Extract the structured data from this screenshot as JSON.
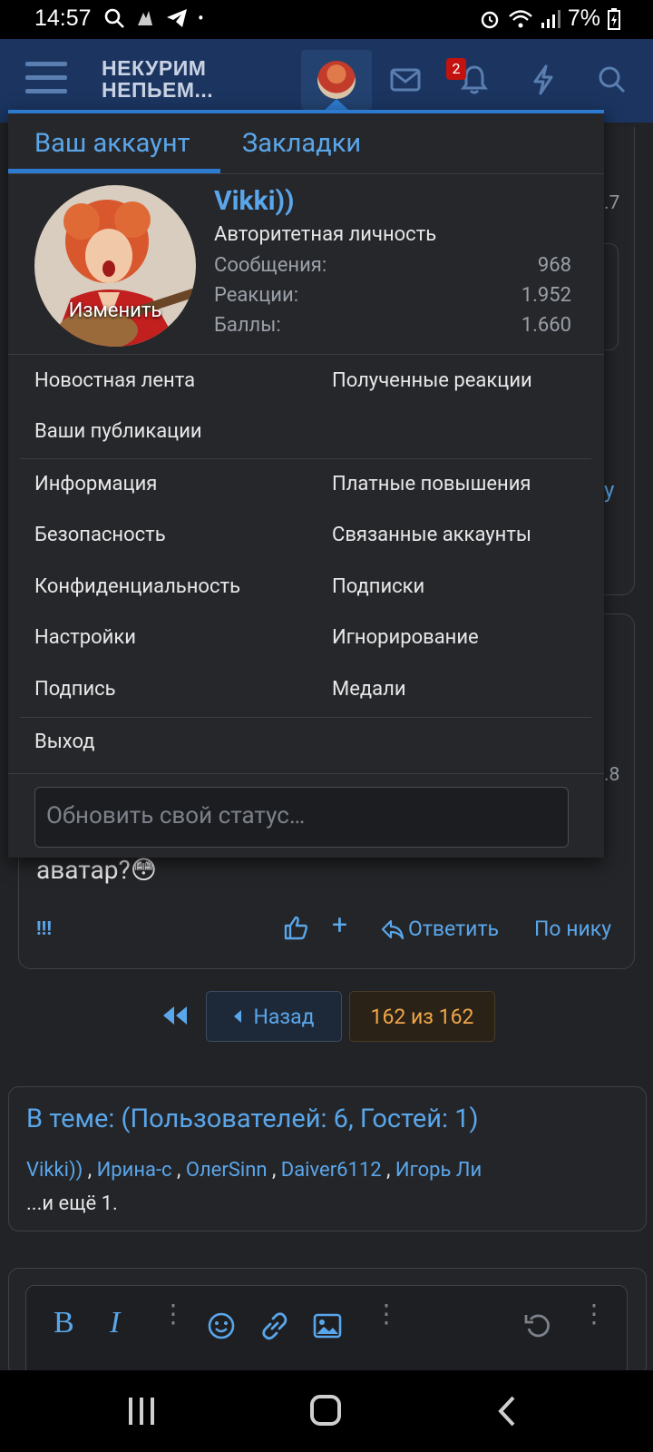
{
  "status_bar": {
    "time": "14:57",
    "battery": "7%"
  },
  "header": {
    "logo_line1": "НЕКУРИМ",
    "logo_line2": "НЕПЬЕМ...",
    "alerts_count": "2"
  },
  "account_menu": {
    "tabs": [
      "Ваш аккаунт",
      "Закладки"
    ],
    "user": {
      "name": "Vikki))",
      "title": "Авторитетная личность",
      "avatar_action": "Изменить",
      "stats": [
        {
          "label": "Сообщения:",
          "value": "968"
        },
        {
          "label": "Реакции:",
          "value": "1.952"
        },
        {
          "label": "Баллы:",
          "value": "1.660"
        }
      ]
    },
    "links_group1": {
      "left": [
        "Новостная лента",
        "Ваши публикации"
      ],
      "right": [
        "Полученные реакции"
      ]
    },
    "links_group2": {
      "left": [
        "Информация",
        "Безопасность",
        "Конфиденциальность",
        "Настройки",
        "Подпись"
      ],
      "right": [
        "Платные повышения",
        "Связанные аккаунты",
        "Подписки",
        "Игнорирование",
        "Медали"
      ]
    },
    "logout": "Выход",
    "status_placeholder": "Обновить свой статус…"
  },
  "background_post": {
    "text": "аватар?😳",
    "side_fragments": [
      ".7",
      "у",
      ".8"
    ],
    "actions": {
      "report": "!!!",
      "reply": "Ответить",
      "by_nick": "По нику"
    }
  },
  "pagination": {
    "back": "Назад",
    "current": "162 из 162"
  },
  "online_block": {
    "title": "В теме: (Пользователей: 6, Гостей: 1)",
    "users": [
      "Vikki))",
      "Ирина-с",
      "OлerSinn",
      "Daiver6112",
      "Игорь Ли"
    ],
    "more": "...и ещё 1."
  },
  "colors": {
    "accent": "#2d7bd0",
    "link": "#5aa6ea",
    "header_bg": "#1b3560",
    "page_bg": "#222326",
    "current_page": "#f0a64a"
  }
}
